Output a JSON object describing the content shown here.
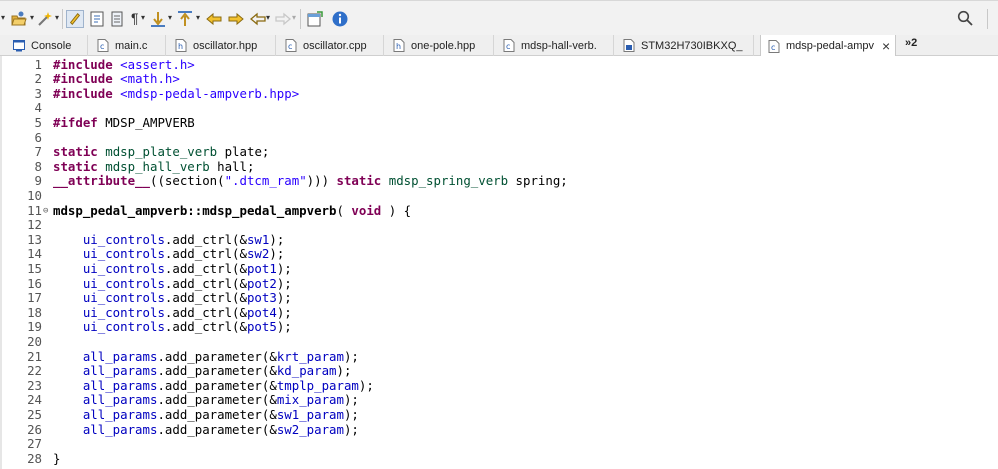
{
  "toolbar": {
    "icons": [
      "dropdown-arrow",
      "open-folder-icon",
      "wand-icon",
      "highlight-icon",
      "bookmark-icon",
      "document-icon",
      "pilcrow-icon",
      "next-annotation-icon",
      "previous-annotation-icon",
      "back-icon",
      "forward-icon",
      "history-back-icon",
      "history-forward-icon",
      "new-window-icon",
      "info-icon",
      "search-icon"
    ]
  },
  "tabs": [
    {
      "label": "Console",
      "icon": "console-icon",
      "active": false
    },
    {
      "label": "main.c",
      "icon": "c-file-icon",
      "active": false
    },
    {
      "label": "oscillator.hpp",
      "icon": "h-file-icon",
      "active": false
    },
    {
      "label": "oscillator.cpp",
      "icon": "c-file-icon",
      "active": false
    },
    {
      "label": "one-pole.hpp",
      "icon": "h-file-icon",
      "active": false
    },
    {
      "label": "mdsp-hall-verb.",
      "icon": "c-file-icon",
      "active": false
    },
    {
      "label": "STM32H730IBKXQ_",
      "icon": "chip-file-icon",
      "active": false
    },
    {
      "label": "mdsp-pedal-ampv",
      "icon": "c-file-icon",
      "active": true
    }
  ],
  "tab_overflow": "»2",
  "close_glyph": "×",
  "editor": {
    "lines": [
      {
        "n": "1",
        "segs": [
          {
            "t": "#include",
            "c": "kw"
          },
          {
            "t": " "
          },
          {
            "t": "<assert.h>",
            "c": "str"
          }
        ]
      },
      {
        "n": "2",
        "segs": [
          {
            "t": "#include",
            "c": "kw"
          },
          {
            "t": " "
          },
          {
            "t": "<math.h>",
            "c": "str"
          }
        ]
      },
      {
        "n": "3",
        "segs": [
          {
            "t": "#include",
            "c": "kw"
          },
          {
            "t": " "
          },
          {
            "t": "<mdsp-pedal-ampverb.hpp>",
            "c": "str"
          }
        ]
      },
      {
        "n": "4",
        "segs": []
      },
      {
        "n": "5",
        "segs": [
          {
            "t": "#ifdef",
            "c": "kw"
          },
          {
            "t": " MDSP_AMPVERB"
          }
        ]
      },
      {
        "n": "6",
        "segs": []
      },
      {
        "n": "7",
        "segs": [
          {
            "t": "static",
            "c": "kw"
          },
          {
            "t": " "
          },
          {
            "t": "mdsp_plate_verb",
            "c": "type"
          },
          {
            "t": " plate;"
          }
        ]
      },
      {
        "n": "8",
        "segs": [
          {
            "t": "static",
            "c": "kw"
          },
          {
            "t": " "
          },
          {
            "t": "mdsp_hall_verb",
            "c": "type"
          },
          {
            "t": " hall;"
          }
        ]
      },
      {
        "n": "9",
        "segs": [
          {
            "t": "__attribute__",
            "c": "kw"
          },
          {
            "t": "((section("
          },
          {
            "t": "\".dtcm_ram\"",
            "c": "str"
          },
          {
            "t": "))) "
          },
          {
            "t": "static",
            "c": "kw"
          },
          {
            "t": " "
          },
          {
            "t": "mdsp_spring_verb",
            "c": "type"
          },
          {
            "t": " spring;"
          }
        ]
      },
      {
        "n": "10",
        "segs": []
      },
      {
        "n": "11",
        "fold": true,
        "segs": [
          {
            "t": "mdsp_pedal_ampverb::mdsp_pedal_ampverb",
            "c": "fn"
          },
          {
            "t": "( "
          },
          {
            "t": "void",
            "c": "kw"
          },
          {
            "t": " ) {"
          }
        ]
      },
      {
        "n": "12",
        "segs": []
      },
      {
        "n": "13",
        "segs": [
          {
            "t": "    "
          },
          {
            "t": "ui_controls",
            "c": "fld"
          },
          {
            "t": ".add_ctrl(&"
          },
          {
            "t": "sw1",
            "c": "fld"
          },
          {
            "t": ");"
          }
        ]
      },
      {
        "n": "14",
        "segs": [
          {
            "t": "    "
          },
          {
            "t": "ui_controls",
            "c": "fld"
          },
          {
            "t": ".add_ctrl(&"
          },
          {
            "t": "sw2",
            "c": "fld"
          },
          {
            "t": ");"
          }
        ]
      },
      {
        "n": "15",
        "segs": [
          {
            "t": "    "
          },
          {
            "t": "ui_controls",
            "c": "fld"
          },
          {
            "t": ".add_ctrl(&"
          },
          {
            "t": "pot1",
            "c": "fld"
          },
          {
            "t": ");"
          }
        ]
      },
      {
        "n": "16",
        "segs": [
          {
            "t": "    "
          },
          {
            "t": "ui_controls",
            "c": "fld"
          },
          {
            "t": ".add_ctrl(&"
          },
          {
            "t": "pot2",
            "c": "fld"
          },
          {
            "t": ");"
          }
        ]
      },
      {
        "n": "17",
        "segs": [
          {
            "t": "    "
          },
          {
            "t": "ui_controls",
            "c": "fld"
          },
          {
            "t": ".add_ctrl(&"
          },
          {
            "t": "pot3",
            "c": "fld"
          },
          {
            "t": ");"
          }
        ]
      },
      {
        "n": "18",
        "segs": [
          {
            "t": "    "
          },
          {
            "t": "ui_controls",
            "c": "fld"
          },
          {
            "t": ".add_ctrl(&"
          },
          {
            "t": "pot4",
            "c": "fld"
          },
          {
            "t": ");"
          }
        ]
      },
      {
        "n": "19",
        "segs": [
          {
            "t": "    "
          },
          {
            "t": "ui_controls",
            "c": "fld"
          },
          {
            "t": ".add_ctrl(&"
          },
          {
            "t": "pot5",
            "c": "fld"
          },
          {
            "t": ");"
          }
        ]
      },
      {
        "n": "20",
        "segs": []
      },
      {
        "n": "21",
        "segs": [
          {
            "t": "    "
          },
          {
            "t": "all_params",
            "c": "fld"
          },
          {
            "t": ".add_parameter(&"
          },
          {
            "t": "krt_param",
            "c": "fld"
          },
          {
            "t": ");"
          }
        ]
      },
      {
        "n": "22",
        "segs": [
          {
            "t": "    "
          },
          {
            "t": "all_params",
            "c": "fld"
          },
          {
            "t": ".add_parameter(&"
          },
          {
            "t": "kd_param",
            "c": "fld"
          },
          {
            "t": ");"
          }
        ]
      },
      {
        "n": "23",
        "segs": [
          {
            "t": "    "
          },
          {
            "t": "all_params",
            "c": "fld"
          },
          {
            "t": ".add_parameter(&"
          },
          {
            "t": "tmplp_param",
            "c": "fld"
          },
          {
            "t": ");"
          }
        ]
      },
      {
        "n": "24",
        "segs": [
          {
            "t": "    "
          },
          {
            "t": "all_params",
            "c": "fld"
          },
          {
            "t": ".add_parameter(&"
          },
          {
            "t": "mix_param",
            "c": "fld"
          },
          {
            "t": ");"
          }
        ]
      },
      {
        "n": "25",
        "segs": [
          {
            "t": "    "
          },
          {
            "t": "all_params",
            "c": "fld"
          },
          {
            "t": ".add_parameter(&"
          },
          {
            "t": "sw1_param",
            "c": "fld"
          },
          {
            "t": ");"
          }
        ]
      },
      {
        "n": "26",
        "segs": [
          {
            "t": "    "
          },
          {
            "t": "all_params",
            "c": "fld"
          },
          {
            "t": ".add_parameter(&"
          },
          {
            "t": "sw2_param",
            "c": "fld"
          },
          {
            "t": ");"
          }
        ]
      },
      {
        "n": "27",
        "segs": []
      },
      {
        "n": "28",
        "segs": [
          {
            "t": "}"
          }
        ]
      }
    ]
  },
  "colors": {
    "keyword": "#7f0055",
    "string": "#2a00ff",
    "field": "#0000c0",
    "type": "#005032",
    "text": "#000000"
  }
}
